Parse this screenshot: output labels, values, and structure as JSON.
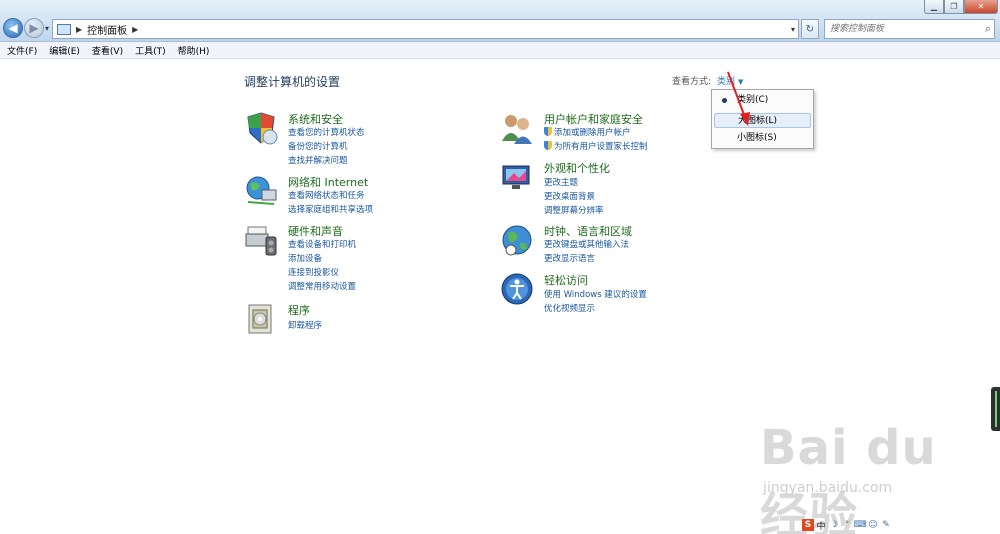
{
  "address": {
    "crumb": "控制面板"
  },
  "search": {
    "placeholder": "搜索控制面板"
  },
  "menu": [
    "文件(F)",
    "编辑(E)",
    "查看(V)",
    "工具(T)",
    "帮助(H)"
  ],
  "page_title": "调整计算机的设置",
  "view_by": {
    "label": "查看方式:",
    "value": "类别"
  },
  "dropdown": {
    "items": [
      {
        "label": "类别(C)",
        "selected_dot": true
      },
      {
        "label": "大图标(L)",
        "highlighted": true
      },
      {
        "label": "小图标(S)"
      }
    ]
  },
  "categories_left": [
    {
      "title": "系统和安全",
      "icon": "shield-icon",
      "links": [
        "查看您的计算机状态",
        "备份您的计算机",
        "查找并解决问题"
      ]
    },
    {
      "title": "网络和 Internet",
      "icon": "network-icon",
      "links": [
        "查看网络状态和任务",
        "选择家庭组和共享选项"
      ]
    },
    {
      "title": "硬件和声音",
      "icon": "printer-icon",
      "links": [
        "查看设备和打印机",
        "添加设备",
        "连接到投影仪",
        "调整常用移动设置"
      ]
    },
    {
      "title": "程序",
      "icon": "programs-icon",
      "links": [
        "卸载程序"
      ]
    }
  ],
  "categories_right": [
    {
      "title": "用户帐户和家庭安全",
      "icon": "users-icon",
      "links": [
        "添加或删除用户帐户",
        "为所有用户设置家长控制"
      ]
    },
    {
      "title": "外观和个性化",
      "icon": "display-icon",
      "links": [
        "更改主题",
        "更改桌面背景",
        "调整屏幕分辨率"
      ]
    },
    {
      "title": "时钟、语言和区域",
      "icon": "globe-clock-icon",
      "links": [
        "更改键盘或其他输入法",
        "更改显示语言"
      ]
    },
    {
      "title": "轻松访问",
      "icon": "ease-of-access-icon",
      "links": [
        "使用 Windows 建议的设置",
        "优化视频显示"
      ]
    }
  ],
  "watermark": {
    "logo": "Bai du 经验",
    "sub": "jingyan.baidu.com"
  },
  "tray": {
    "ime": "中"
  }
}
